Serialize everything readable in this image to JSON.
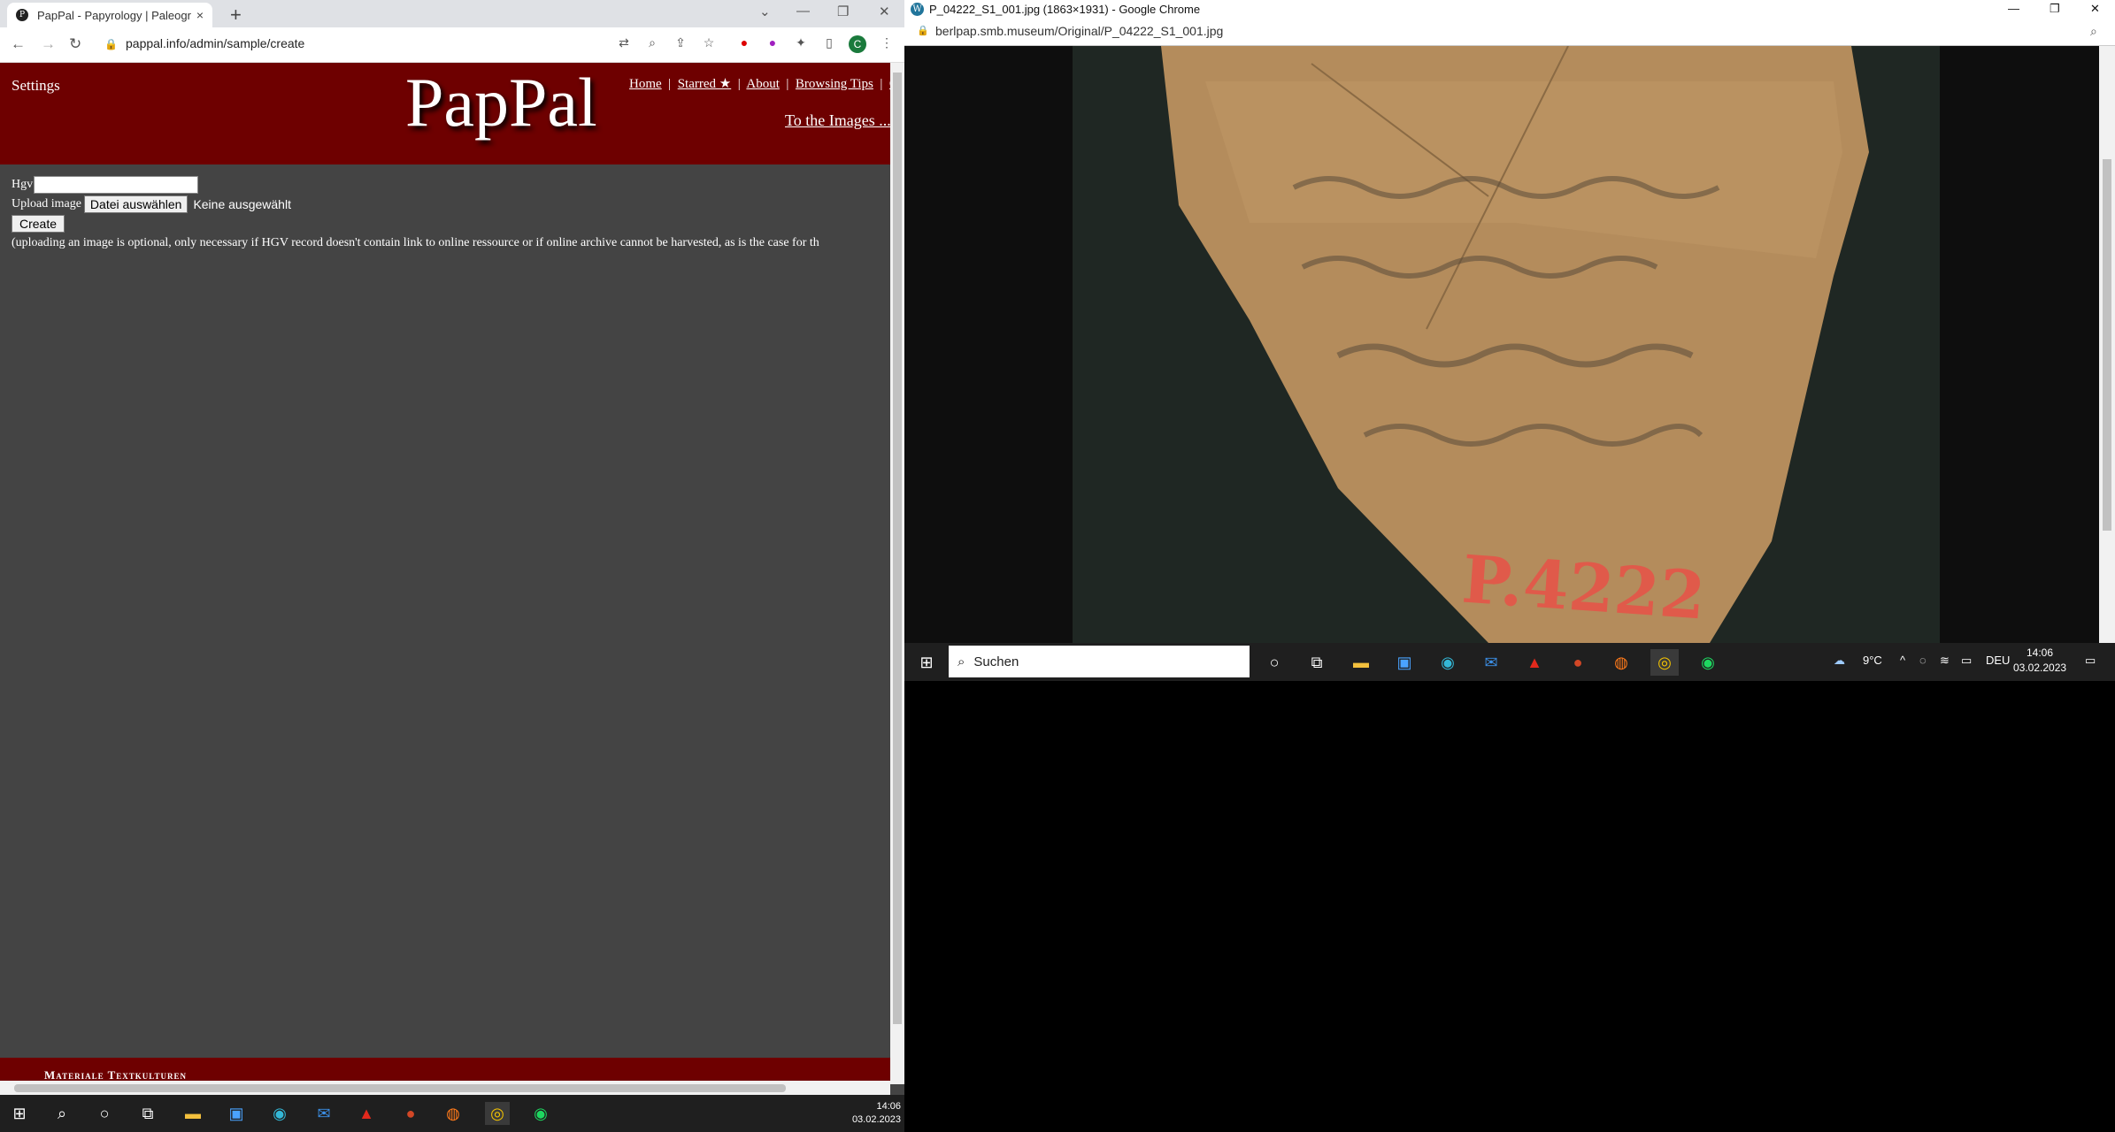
{
  "left_window": {
    "tab_title": "PapPal - Papyrology | Paleograph",
    "tab_close": "×",
    "new_tab": "+",
    "url": "pappal.info/admin/sample/create",
    "profile_initial": "C",
    "site": {
      "settings": "Settings",
      "logo": "PapPal",
      "nav": [
        "Home",
        "Starred ★",
        "About",
        "Browsing Tips",
        "C"
      ],
      "to_images": "To the Images ..."
    },
    "form": {
      "hgv_label": "Hgv",
      "upload_label": "Upload image",
      "file_button": "Datei auswählen",
      "file_status": "Keine ausgewählt",
      "create_button": "Create",
      "note": "(uploading an image is optional, only necessary if HGV record doesn't contain link to online ressource or if online archive cannot be harvested, as is the case for th"
    },
    "footer": "Materiale Textkulturen",
    "taskbar_time": "14:06",
    "taskbar_date": "03.02.2023"
  },
  "right_window": {
    "title": "P_04222_S1_001.jpg (1863×1931) - Google Chrome",
    "url": "berlpap.smb.museum/Original/P_04222_S1_001.jpg",
    "image_label": "P.4222",
    "taskbar": {
      "search_placeholder": "Suchen",
      "weather": "9°C",
      "language": "DEU",
      "time": "14:06",
      "date": "03.02.2023"
    }
  },
  "colors": {
    "header_bg": "#6e0000",
    "page_bg": "#444444",
    "taskbar_bg": "#1f1f1f"
  }
}
